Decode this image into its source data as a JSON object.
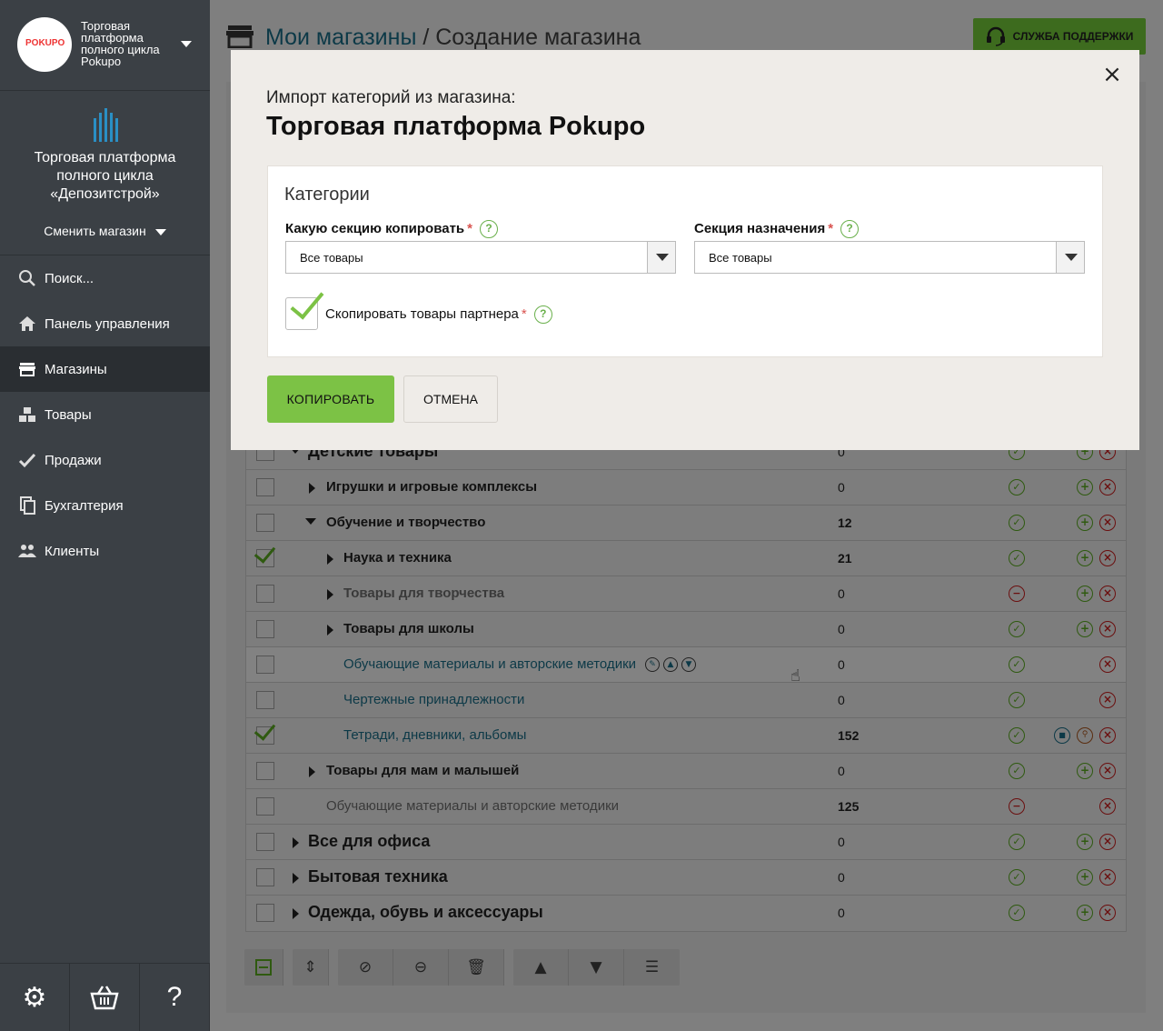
{
  "sidebar": {
    "shop_name": "Торговая платформа полного цикла Pokupo",
    "logo_text": "POKUPO",
    "brand_name": "Торговая платформа полного цикла «Депозитстрой»",
    "switch_label": "Сменить магазин",
    "nav": [
      {
        "label": "Поиск...",
        "icon": "search-icon"
      },
      {
        "label": "Панель управления",
        "icon": "home-icon"
      },
      {
        "label": "Магазины",
        "icon": "store-icon",
        "active": true
      },
      {
        "label": "Товары",
        "icon": "boxes-icon"
      },
      {
        "label": "Продажи",
        "icon": "check-icon"
      },
      {
        "label": "Бухгалтерия",
        "icon": "documents-icon"
      },
      {
        "label": "Клиенты",
        "icon": "users-icon"
      }
    ],
    "bottom": {
      "settings": "⚙",
      "basket": "🧺",
      "help": "?"
    }
  },
  "header": {
    "link": "Мои магазины",
    "separator": " / ",
    "title": "Создание магазина",
    "support": "СЛУЖБА ПОДДЕРЖКИ"
  },
  "table": {
    "rows": [
      {
        "name": "Детские товары",
        "count": "0",
        "status": "on",
        "checked": false
      },
      {
        "name": "Игрушки и игровые комплексы",
        "count": "0",
        "status": "on",
        "checked": false
      },
      {
        "name": "Обучение и творчество",
        "count": "12",
        "status": "on",
        "checked": false
      },
      {
        "name": "Наука и техника",
        "count": "21",
        "status": "on",
        "checked": true
      },
      {
        "name": "Товары для творчества",
        "count": "0",
        "status": "off",
        "checked": false
      },
      {
        "name": "Товары для школы",
        "count": "0",
        "status": "on",
        "checked": false
      },
      {
        "name": "Обучающие материалы и авторские методики",
        "count": "0",
        "status": "on",
        "checked": false
      },
      {
        "name": "Чертежные принадлежности",
        "count": "0",
        "status": "on",
        "checked": false
      },
      {
        "name": "Тетради, дневники, альбомы",
        "count": "152",
        "status": "on",
        "checked": true
      },
      {
        "name": "Товары для мам и малышей",
        "count": "0",
        "status": "on",
        "checked": false
      },
      {
        "name": "Обучающие материалы и авторские методики",
        "count": "125",
        "status": "off",
        "checked": false
      },
      {
        "name": "Все для офиса",
        "count": "0",
        "status": "on",
        "checked": false
      },
      {
        "name": "Бытовая техника",
        "count": "0",
        "status": "on",
        "checked": false
      },
      {
        "name": "Одежда, обувь и аксессуары",
        "count": "0",
        "status": "on",
        "checked": false
      }
    ]
  },
  "modal": {
    "subtitle": "Импорт категорий из магазина:",
    "title": "Торговая платформа Pokupo",
    "panel_title": "Категории",
    "source_label": "Какую секцию копировать",
    "source_value": "Все товары",
    "target_label": "Секция назначения",
    "target_value": "Все товары",
    "required_mark": "*",
    "help_mark": "?",
    "copy_partner_label": "Скопировать товары партнера",
    "copy_partner_checked": true,
    "copy_button": "КОПИРОВАТЬ",
    "cancel_button": "ОТМЕНА",
    "close": "×"
  },
  "colors": {
    "accent_green": "#7cc245",
    "sidebar_bg": "#3b4045",
    "link": "#0c3947"
  }
}
